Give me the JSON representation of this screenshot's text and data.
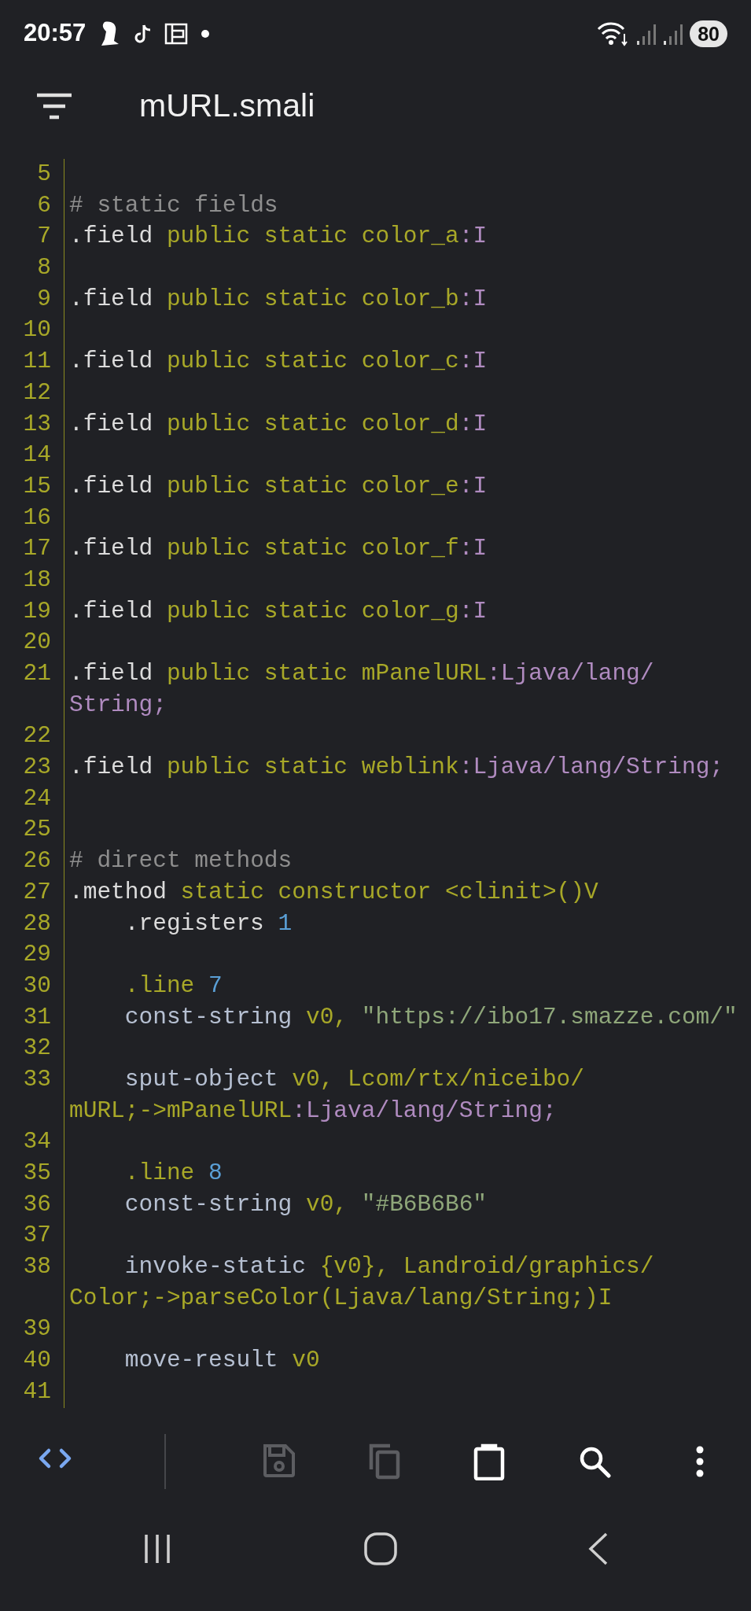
{
  "status_bar": {
    "time": "20:57",
    "battery": "80"
  },
  "app_bar": {
    "title": "mURL.smali"
  },
  "editor": {
    "lines": [
      {
        "number": "5"
      },
      {
        "number": "6",
        "indented": false,
        "tokens": [
          {
            "kind": "comment",
            "text": "# static fields"
          }
        ]
      },
      {
        "number": "7",
        "indented": false,
        "tokens": [
          {
            "kind": "directive",
            "text": ".field"
          },
          {
            "kind": "keyword",
            "text": " public static color_a"
          },
          {
            "kind": "type",
            "text": ":I"
          }
        ]
      },
      {
        "number": "8"
      },
      {
        "number": "9",
        "indented": false,
        "tokens": [
          {
            "kind": "directive",
            "text": ".field"
          },
          {
            "kind": "keyword",
            "text": " public static color_b"
          },
          {
            "kind": "type",
            "text": ":I"
          }
        ]
      },
      {
        "number": "10"
      },
      {
        "number": "11",
        "indented": false,
        "tokens": [
          {
            "kind": "directive",
            "text": ".field"
          },
          {
            "kind": "keyword",
            "text": " public static color_c"
          },
          {
            "kind": "type",
            "text": ":I"
          }
        ]
      },
      {
        "number": "12"
      },
      {
        "number": "13",
        "indented": false,
        "tokens": [
          {
            "kind": "directive",
            "text": ".field"
          },
          {
            "kind": "keyword",
            "text": " public static color_d"
          },
          {
            "kind": "type",
            "text": ":I"
          }
        ]
      },
      {
        "number": "14"
      },
      {
        "number": "15",
        "indented": false,
        "tokens": [
          {
            "kind": "directive",
            "text": ".field"
          },
          {
            "kind": "keyword",
            "text": " public static color_e"
          },
          {
            "kind": "type",
            "text": ":I"
          }
        ]
      },
      {
        "number": "16"
      },
      {
        "number": "17",
        "indented": false,
        "tokens": [
          {
            "kind": "directive",
            "text": ".field"
          },
          {
            "kind": "keyword",
            "text": " public static color_f"
          },
          {
            "kind": "type",
            "text": ":I"
          }
        ]
      },
      {
        "number": "18"
      },
      {
        "number": "19",
        "indented": false,
        "tokens": [
          {
            "kind": "directive",
            "text": ".field"
          },
          {
            "kind": "keyword",
            "text": " public static color_g"
          },
          {
            "kind": "type",
            "text": ":I"
          }
        ]
      },
      {
        "number": "20"
      },
      {
        "number": "21",
        "indented": false,
        "tokens": [
          {
            "kind": "directive",
            "text": ".field"
          },
          {
            "kind": "keyword",
            "text": " public static mPanelURL"
          },
          {
            "kind": "type",
            "text": ":Ljava/lang/"
          }
        ],
        "continuation": [
          {
            "kind": "type",
            "text": "String;"
          }
        ]
      },
      {
        "number": "22"
      },
      {
        "number": "23",
        "indented": false,
        "tokens": [
          {
            "kind": "directive",
            "text": ".field"
          },
          {
            "kind": "keyword",
            "text": " public static weblink"
          },
          {
            "kind": "type",
            "text": ":Ljava/lang/String;"
          }
        ]
      },
      {
        "number": "24"
      },
      {
        "number": "25"
      },
      {
        "number": "26",
        "indented": false,
        "tokens": [
          {
            "kind": "comment",
            "text": "# direct methods"
          }
        ]
      },
      {
        "number": "27",
        "indented": false,
        "tokens": [
          {
            "kind": "directive",
            "text": ".method"
          },
          {
            "kind": "keyword",
            "text": " static constructor <clinit>()V"
          }
        ]
      },
      {
        "number": "28",
        "indented": true,
        "tokens": [
          {
            "kind": "directive",
            "text": ".registers"
          },
          {
            "kind": "number",
            "text": " 1"
          }
        ]
      },
      {
        "number": "29"
      },
      {
        "number": "30",
        "indented": true,
        "tokens": [
          {
            "kind": "keyword",
            "text": ".line"
          },
          {
            "kind": "number",
            "text": " 7"
          }
        ]
      },
      {
        "number": "31",
        "indented": true,
        "tokens": [
          {
            "kind": "instruction",
            "text": "const-string"
          },
          {
            "kind": "keyword",
            "text": " v0,"
          },
          {
            "kind": "string",
            "text": " \"https://ibo17.smazze.com/\""
          }
        ]
      },
      {
        "number": "32"
      },
      {
        "number": "33",
        "indented": true,
        "tokens": [
          {
            "kind": "instruction",
            "text": "sput-object"
          },
          {
            "kind": "keyword",
            "text": " v0, Lcom/rtx/niceibo/"
          }
        ],
        "continuation": [
          {
            "kind": "keyword",
            "text": "mURL;->mPanelURL"
          },
          {
            "kind": "type",
            "text": ":Ljava/lang/String;"
          }
        ]
      },
      {
        "number": "34"
      },
      {
        "number": "35",
        "indented": true,
        "tokens": [
          {
            "kind": "keyword",
            "text": ".line"
          },
          {
            "kind": "number",
            "text": " 8"
          }
        ]
      },
      {
        "number": "36",
        "indented": true,
        "tokens": [
          {
            "kind": "instruction",
            "text": "const-string"
          },
          {
            "kind": "keyword",
            "text": " v0,"
          },
          {
            "kind": "string",
            "text": " \"#B6B6B6\""
          }
        ]
      },
      {
        "number": "37"
      },
      {
        "number": "38",
        "indented": true,
        "tokens": [
          {
            "kind": "instruction",
            "text": "invoke-static"
          },
          {
            "kind": "keyword",
            "text": " {v0}, Landroid/graphics/"
          }
        ],
        "continuation": [
          {
            "kind": "keyword",
            "text": "Color;->parseColor(Ljava/lang/String;)I"
          }
        ]
      },
      {
        "number": "39"
      },
      {
        "number": "40",
        "indented": true,
        "tokens": [
          {
            "kind": "instruction",
            "text": "move-result"
          },
          {
            "kind": "keyword",
            "text": " v0"
          }
        ]
      },
      {
        "number": "41"
      }
    ]
  },
  "toolbar": [
    {
      "kind": "code",
      "selected": true,
      "disabled": false
    },
    {
      "kind": "save",
      "selected": false,
      "disabled": true
    },
    {
      "kind": "copy",
      "selected": false,
      "disabled": true
    },
    {
      "kind": "paste",
      "selected": false,
      "disabled": false
    },
    {
      "kind": "search",
      "selected": false,
      "disabled": false
    },
    {
      "kind": "more",
      "selected": false,
      "disabled": false
    }
  ]
}
